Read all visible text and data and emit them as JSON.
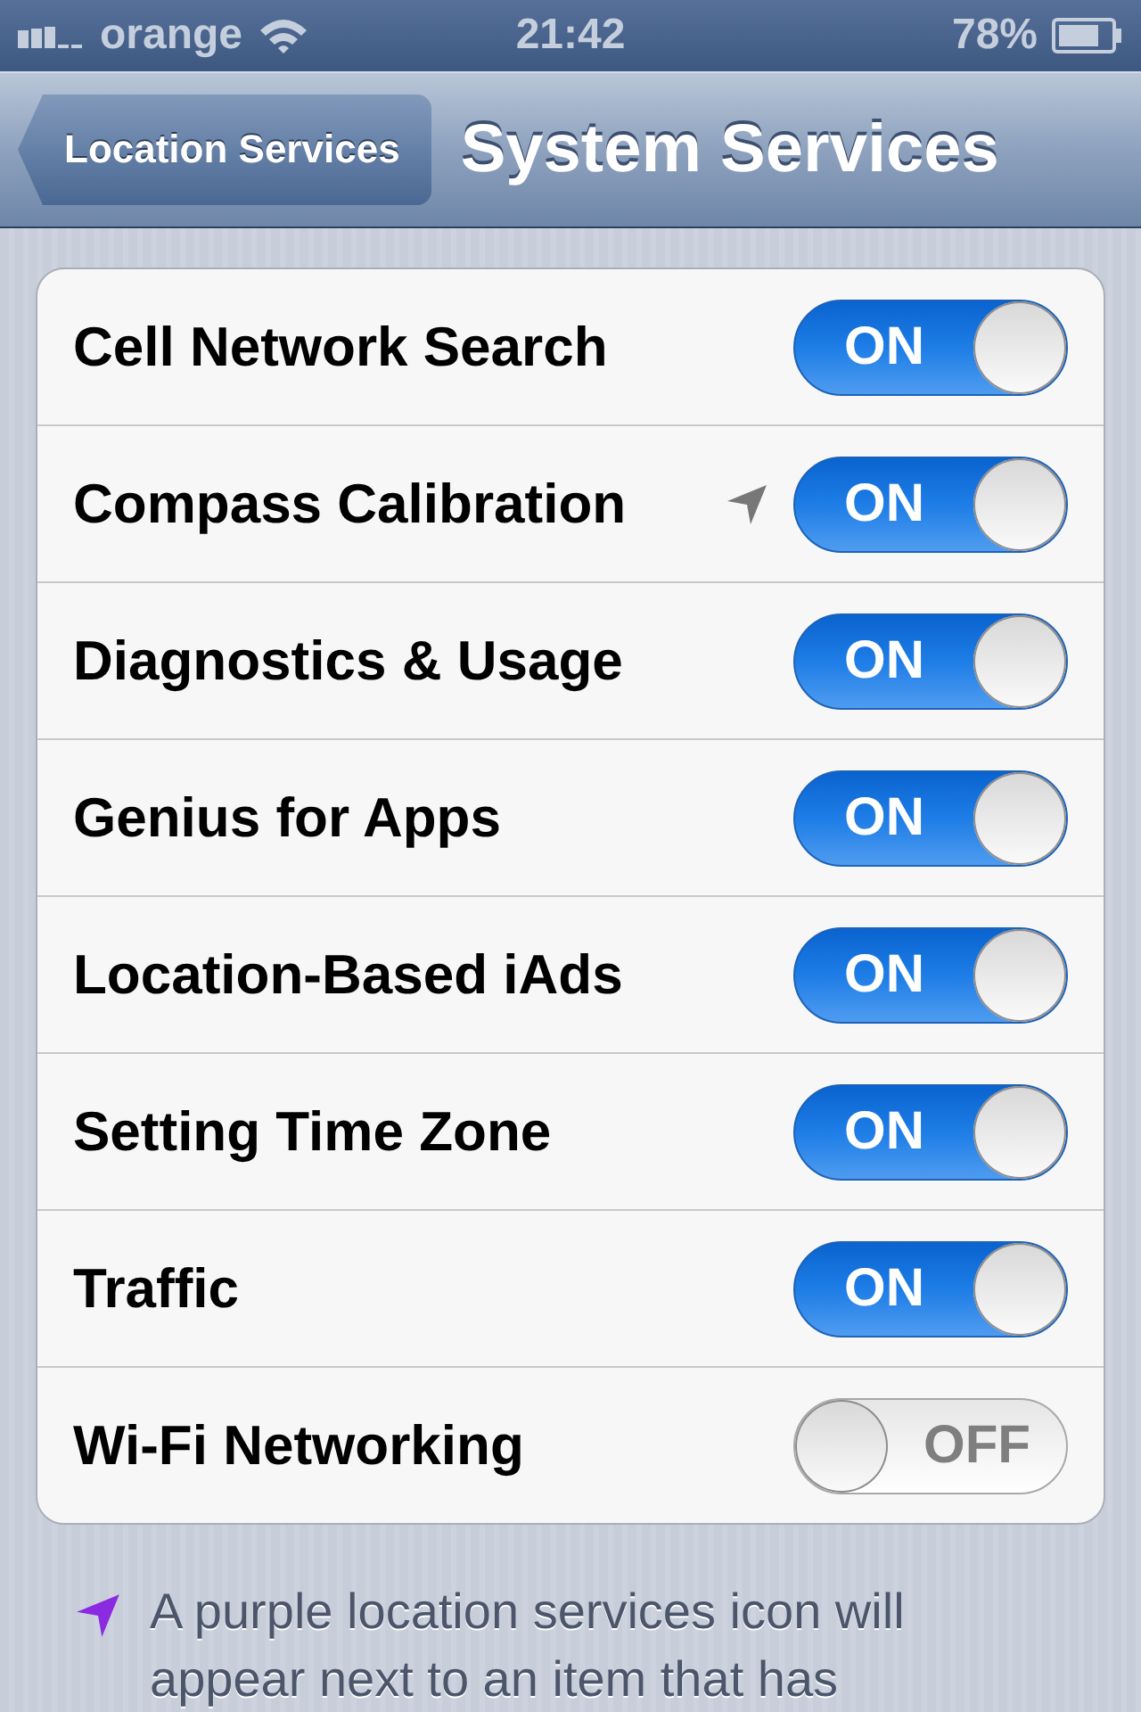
{
  "status_bar": {
    "carrier": "orange",
    "time": "21:42",
    "battery": "78%"
  },
  "nav": {
    "back": "Location Services",
    "title": "System Services"
  },
  "rows": [
    {
      "label": "Cell Network Search",
      "on": true,
      "location_icon": false,
      "switch_text": "ON"
    },
    {
      "label": "Compass Calibration",
      "on": true,
      "location_icon": true,
      "switch_text": "ON"
    },
    {
      "label": "Diagnostics & Usage",
      "on": true,
      "location_icon": false,
      "switch_text": "ON"
    },
    {
      "label": "Genius for Apps",
      "on": true,
      "location_icon": false,
      "switch_text": "ON"
    },
    {
      "label": "Location-Based iAds",
      "on": true,
      "location_icon": false,
      "switch_text": "ON"
    },
    {
      "label": "Setting Time Zone",
      "on": true,
      "location_icon": false,
      "switch_text": "ON"
    },
    {
      "label": "Traffic",
      "on": true,
      "location_icon": false,
      "switch_text": "ON"
    },
    {
      "label": "Wi-Fi Networking",
      "on": false,
      "location_icon": false,
      "switch_text": "OFF"
    }
  ],
  "footer": "A purple location services icon will appear next to an item that has"
}
